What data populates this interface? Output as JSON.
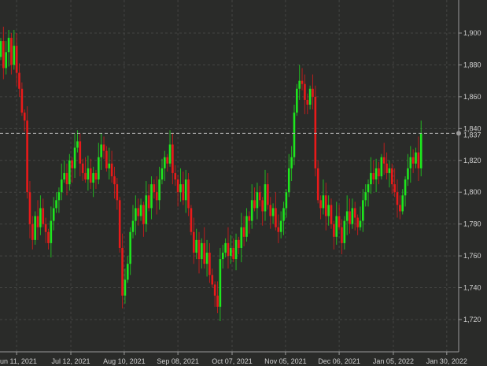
{
  "chart_data": {
    "type": "candlestick",
    "title": "",
    "xlabel": "",
    "ylabel": "",
    "ylim": [
      1700,
      1920
    ],
    "y_ticks": [
      "1,720",
      "1,740",
      "1,760",
      "1,780",
      "1,800",
      "1,820",
      "1,840",
      "1,860",
      "1,880",
      "1,900"
    ],
    "y_tick_values": [
      1720,
      1740,
      1760,
      1780,
      1800,
      1820,
      1840,
      1860,
      1880,
      1900
    ],
    "x_ticks": [
      "Jun 11, 2021",
      "Jul 12, 2021",
      "Aug 10, 2021",
      "Sep 08, 2021",
      "Oct 07, 2021",
      "Nov 05, 2021",
      "Dec 06, 2021",
      "Jan 05, 2022",
      "Jan 30, 2022"
    ],
    "x_tick_candle_index": [
      6,
      26.5,
      46.7,
      67,
      87.5,
      107.7,
      128,
      148.5,
      168.7
    ],
    "grid": true,
    "last_price": 1837,
    "last_price_label": "1,837",
    "colors": {
      "up": "#1ee61e",
      "down": "#e81a1a",
      "background": "#2a2b29",
      "grid": "#444543",
      "axis": "#9a9a9a"
    },
    "first_open": 1885,
    "closes": [
      1895,
      1878,
      1888,
      1897,
      1880,
      1892,
      1875,
      1865,
      1850,
      1845,
      1800,
      1780,
      1770,
      1785,
      1778,
      1790,
      1780,
      1775,
      1768,
      1782,
      1790,
      1795,
      1800,
      1808,
      1812,
      1805,
      1820,
      1815,
      1828,
      1832,
      1818,
      1812,
      1808,
      1815,
      1806,
      1812,
      1808,
      1822,
      1830,
      1826,
      1815,
      1818,
      1810,
      1805,
      1795,
      1765,
      1735,
      1745,
      1755,
      1775,
      1782,
      1790,
      1785,
      1792,
      1780,
      1798,
      1790,
      1805,
      1800,
      1795,
      1808,
      1815,
      1822,
      1818,
      1830,
      1812,
      1808,
      1800,
      1805,
      1795,
      1808,
      1790,
      1775,
      1762,
      1770,
      1758,
      1768,
      1755,
      1762,
      1748,
      1742,
      1735,
      1728,
      1758,
      1762,
      1768,
      1760,
      1765,
      1758,
      1770,
      1765,
      1778,
      1772,
      1785,
      1782,
      1795,
      1790,
      1800,
      1795,
      1788,
      1805,
      1792,
      1785,
      1790,
      1778,
      1775,
      1782,
      1790,
      1800,
      1815,
      1822,
      1850,
      1865,
      1870,
      1868,
      1858,
      1855,
      1865,
      1860,
      1815,
      1795,
      1790,
      1798,
      1785,
      1792,
      1780,
      1772,
      1785,
      1778,
      1768,
      1782,
      1788,
      1780,
      1790,
      1784,
      1778,
      1782,
      1795,
      1800,
      1805,
      1812,
      1808,
      1815,
      1810,
      1822,
      1818,
      1812,
      1815,
      1805,
      1800,
      1792,
      1788,
      1798,
      1808,
      1815,
      1822,
      1818,
      1825,
      1815,
      1837
    ]
  }
}
